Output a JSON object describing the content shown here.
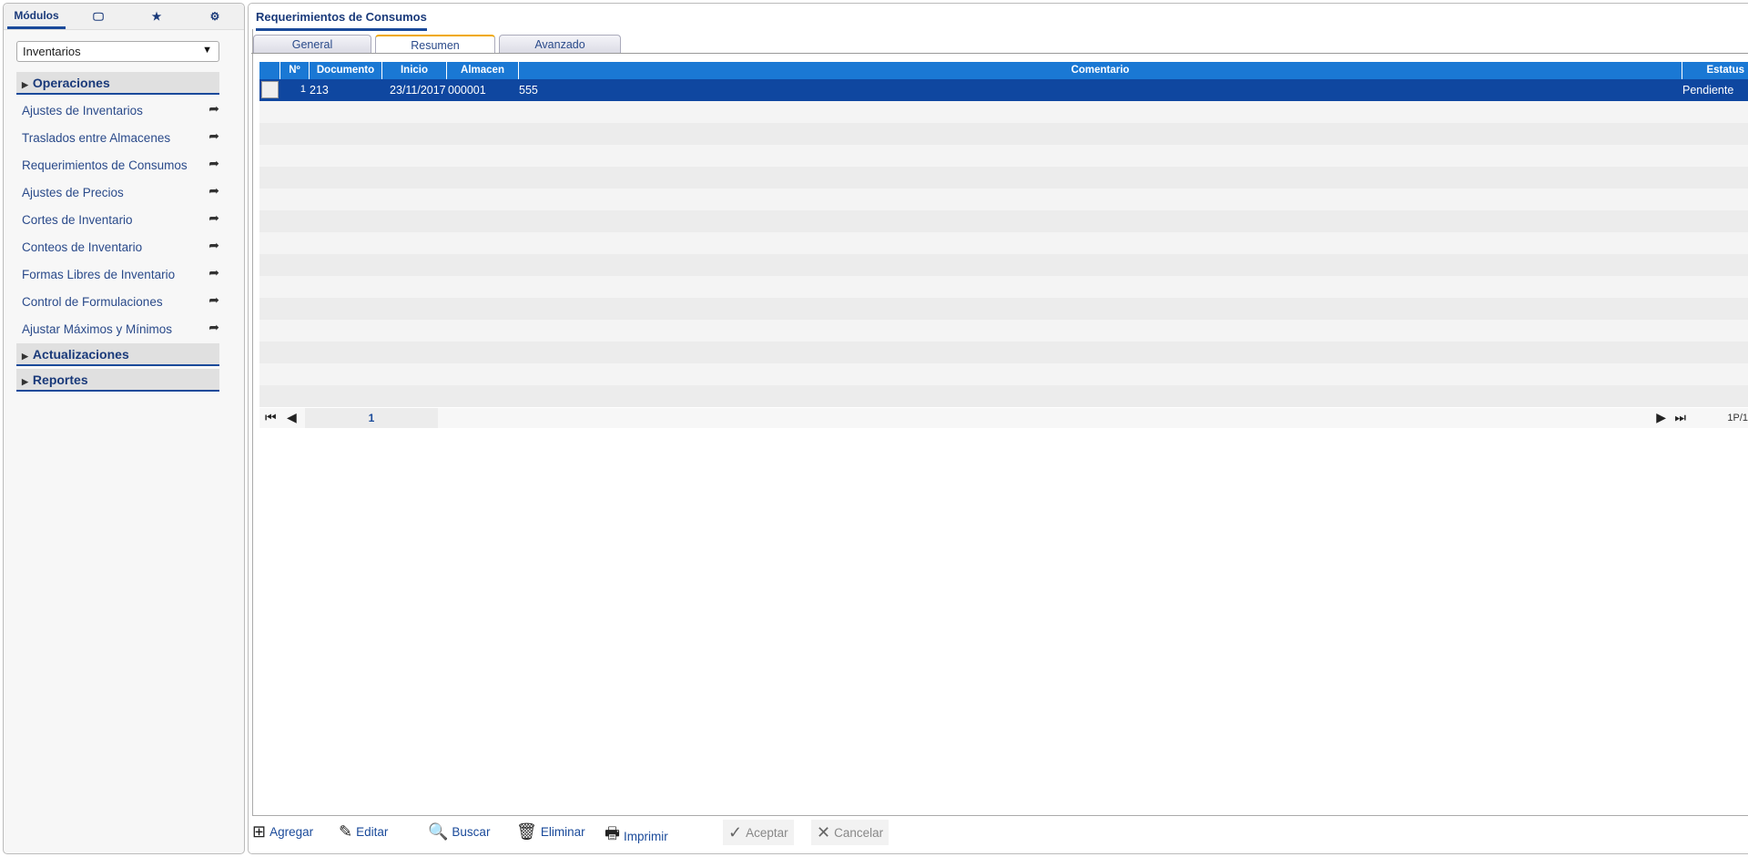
{
  "sidebar": {
    "tabs": [
      "Módulos",
      "monitor-icon",
      "star-icon",
      "settings-icon"
    ],
    "module_select": "Inventarios",
    "groups": {
      "operaciones": "Operaciones",
      "actualizaciones": "Actualizaciones",
      "reportes": "Reportes"
    },
    "items": [
      "Ajustes de Inventarios",
      "Traslados entre Almacenes",
      "Requerimientos de Consumos",
      "Ajustes de Precios",
      "Cortes de Inventario",
      "Conteos de Inventario",
      "Formas Libres de Inventario",
      "Control de Formulaciones",
      "Ajustar Máximos y Mínimos"
    ]
  },
  "main": {
    "title": "Requerimientos de Consumos",
    "tabs": [
      "General",
      "Resumen",
      "Avanzado"
    ],
    "active_tab": "Resumen",
    "grid": {
      "columns": [
        "Nº",
        "Documento",
        "Inicio",
        "Almacen",
        "Comentario",
        "Estatus"
      ],
      "rows": [
        {
          "n": "1",
          "documento": "213",
          "inicio": "23/11/2017",
          "almacen": "000001",
          "comentario": "555",
          "estatus": "Pendiente"
        }
      ]
    },
    "pager": {
      "page": "1",
      "count": "1P/1"
    },
    "toolbar": {
      "add": "Agregar",
      "edit": "Editar",
      "search": "Buscar",
      "delete": "Eliminar",
      "print": "Imprimir",
      "accept": "Aceptar",
      "cancel": "Cancelar"
    }
  },
  "colors": {
    "header": "#1a78d4",
    "selected_row": "#0f47a0",
    "accent": "#1a4a9a",
    "active_tab": "#f0a800"
  }
}
